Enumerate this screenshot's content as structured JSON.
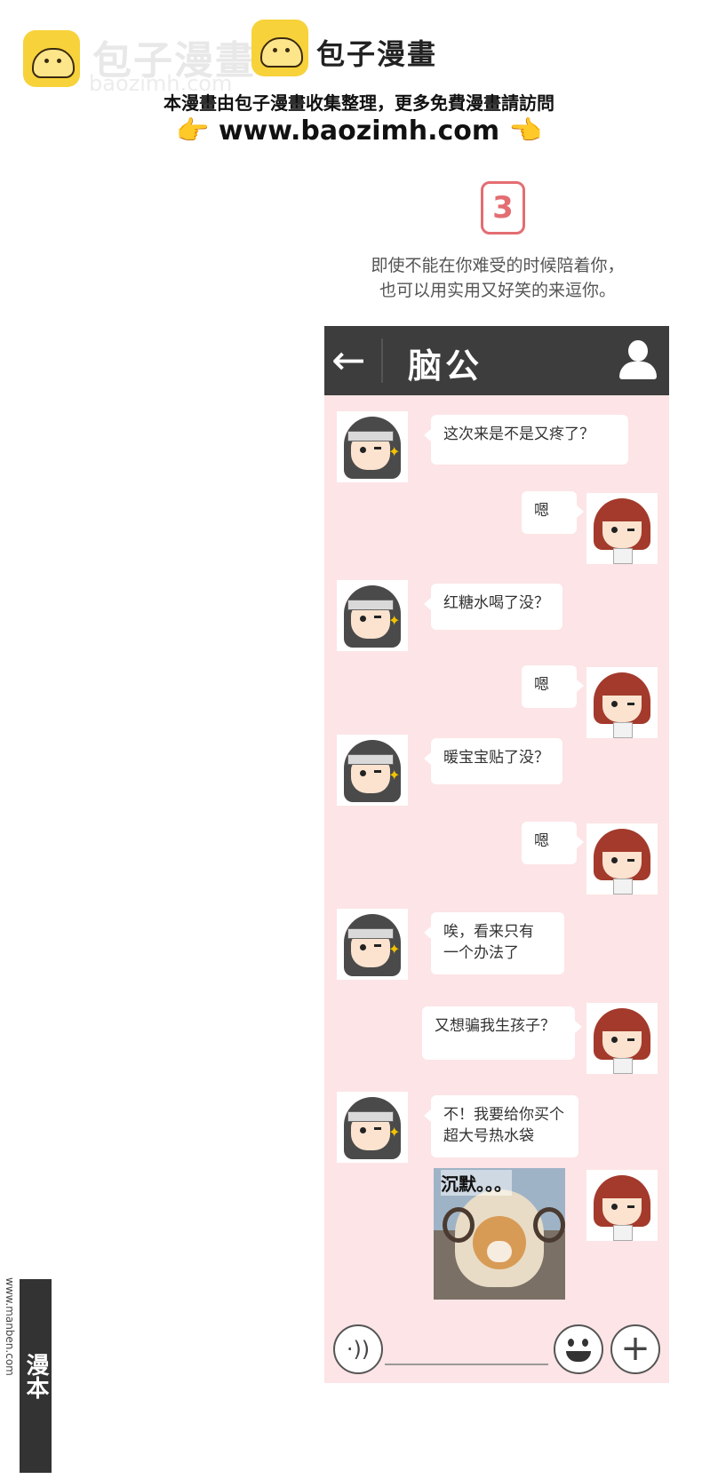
{
  "watermark": {
    "ghost_title": "包子漫畫",
    "ghost_domain": "baozimh.com",
    "brand": "包子漫畫",
    "tagline": "本漫畫由包子漫畫收集整理，更多免費漫畫請訪問",
    "url": "www.baozimh.com",
    "hand_left": "👉",
    "hand_right": "👈"
  },
  "step": {
    "number": "3",
    "line1": "即使不能在你难受的时候陪着你，",
    "line2": "也可以用实用又好笑的来逗你。"
  },
  "chat": {
    "back_icon": "←",
    "title": "脑公",
    "messages": [
      {
        "from": "him",
        "text": "这次来是不是又疼了？"
      },
      {
        "from": "her",
        "text": "嗯"
      },
      {
        "from": "him",
        "text": "红糖水喝了没？"
      },
      {
        "from": "her",
        "text": "嗯"
      },
      {
        "from": "him",
        "text": "暖宝宝贴了没？"
      },
      {
        "from": "her",
        "text": "嗯"
      },
      {
        "from": "him",
        "line1": "唉，看来只有",
        "line2": "一个办法了"
      },
      {
        "from": "her",
        "text": "又想骗我生孩子？"
      },
      {
        "from": "him",
        "line1": "不！我要给你买个",
        "line2": "超大号热水袋"
      },
      {
        "from": "her",
        "image_caption": "沉默。。。"
      }
    ],
    "voice_icon": "·))",
    "plus_icon": "+"
  },
  "side": {
    "url": "www.manben.com",
    "logo": "漫本"
  }
}
